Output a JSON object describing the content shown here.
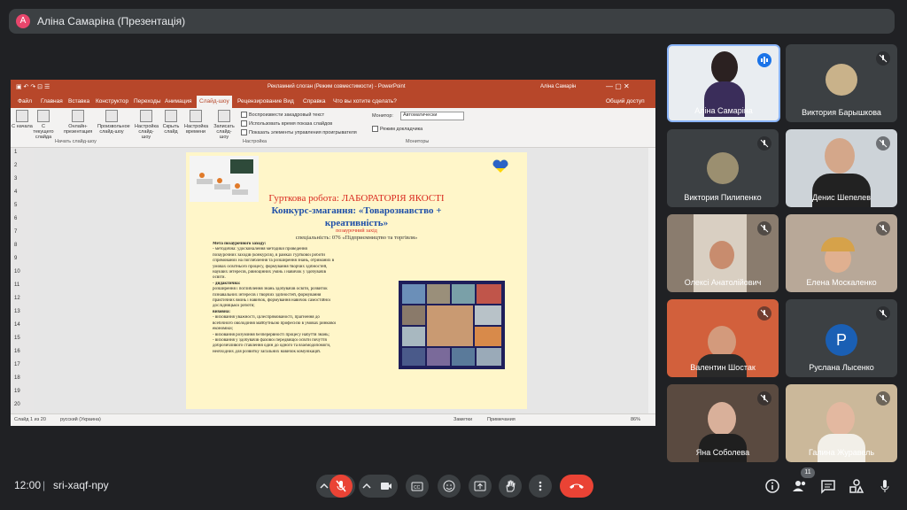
{
  "header": {
    "avatar_letter": "A",
    "title": "Аліна Самаріна (Презентація)"
  },
  "ppt": {
    "window_title": "Рекламний слоган (Режим совместимости) - PowerPoint",
    "user": "Аліна Самарін",
    "tabs": [
      "Файл",
      "Главная",
      "Вставка",
      "Конструктор",
      "Переходы",
      "Анимация",
      "Слайд-шоу",
      "Рецензирование",
      "Вид",
      "Справка",
      "Что вы хотите сделать?"
    ],
    "share": "Общий доступ",
    "ribbon": {
      "buttons": [
        "С начала",
        "С текущего слайда",
        "Онлайн-презентация",
        "Произвольное слайд-шоу",
        "Настройка слайд-шоу",
        "Скрыть слайд",
        "Настройка времени",
        "Записать слайд-шоу"
      ],
      "group_start": "Начать слайд-шоу",
      "group_setup": "Настройка",
      "group_monitors": "Мониторы",
      "checks": [
        "Воспроизвести закадровый текст",
        "Использовать время показа слайдов",
        "Показать элементы управления проигрывателя"
      ],
      "monitor_label": "Монитор:",
      "monitor_value": "Автоматически",
      "presenter_view": "Режим докладчика"
    },
    "slide_numbers": [
      "1",
      "2",
      "3",
      "4",
      "5",
      "6",
      "7",
      "8",
      "9",
      "10",
      "11",
      "12",
      "13",
      "14",
      "15",
      "16",
      "17",
      "18",
      "19",
      "20"
    ],
    "slide": {
      "line1": "Гуртковa робота: ЛАБОРАТОРІЯ ЯКОСТІ",
      "line2": "Конкурс-змагання: «Товарознавство +",
      "line3": "креативність»",
      "line4": "позаурочний захід",
      "line5": "спеціальність: 076 «Підприємництво та торгівля»",
      "body": [
        "Мета позаурочного заходу:",
        "- методична: удосконалення методики проведення",
        "позаурочних заходів (конкурсів), в рамках гурткової роботи",
        "спрямованих на поглиблення та розширення знань, отриманих в",
        "умовах освітнього процесу, формування творчих здібностей,",
        "науквих інтересів, рівноцінних умінь і навичок у здобувачів",
        "освіти.",
        "- дидактична:",
        "розширення і поглиблення знань здобувачів освіти, розвиток",
        "пізнавальних інтересів і творчих здібностей, формування",
        "практичних вмінь і навичок, формування навичок самостійної",
        "дослідницької роботи;",
        "виховна:",
        "- виховання уважності, цілеспрямованості, прагнення до",
        "всебічного оволодіння майбутньою професією в умовах ринкової",
        "економіки;",
        "- виховання розуміння безперервності процесу набуття знань;",
        "- виховання у здобувачів фахової передвищої освіти почуття",
        "доброзичливого ставлення один до одного та взаємодопомоги,",
        "необхідних для розвитку загальних навичок комунікацій."
      ]
    },
    "status": {
      "slide": "Слайд 1 из 20",
      "lang": "русский (Украина)",
      "notes": "Заметки",
      "comments": "Примечания",
      "zoom": "86%"
    }
  },
  "participants": [
    {
      "name": "Аліна Самаріна",
      "muted": false,
      "speaking": true
    },
    {
      "name": "Виктория Барышкова",
      "muted": true
    },
    {
      "name": "Виктория Пилипенко",
      "muted": true
    },
    {
      "name": "Денис Шепелев",
      "muted": true
    },
    {
      "name": "Олексі Анатолійович",
      "muted": true
    },
    {
      "name": "Елена Москаленко",
      "muted": true
    },
    {
      "name": "Валентин Шостак",
      "muted": true
    },
    {
      "name": "Руслана Лысенко",
      "muted": true,
      "avatar_letter": "Р"
    },
    {
      "name": "Яна Соболева",
      "muted": true
    },
    {
      "name": "Галина Журавель",
      "muted": true
    }
  ],
  "bottom": {
    "time": "12:00",
    "separator": "|",
    "meeting_code": "sri-xaqf-npy",
    "people_count": "11"
  },
  "colors": {
    "end_call": "#ea4335",
    "ppt_red": "#b7472a",
    "bg": "#202124"
  }
}
